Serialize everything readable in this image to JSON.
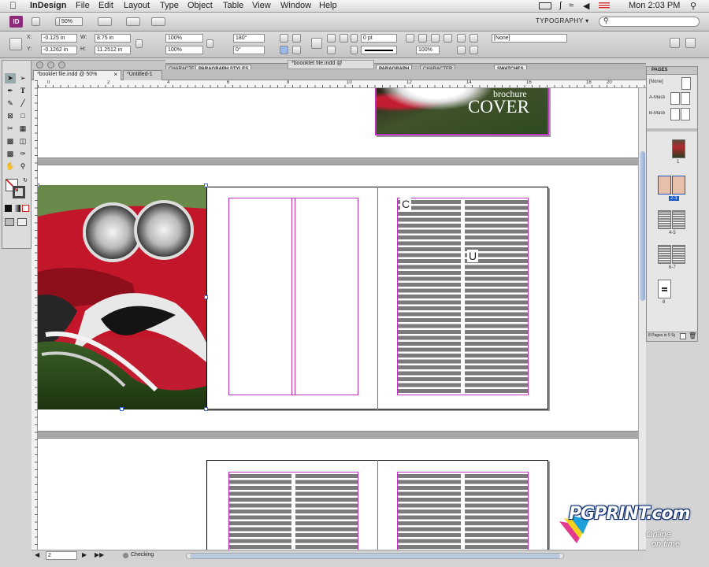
{
  "menubar": {
    "app_name": "InDesign",
    "items": [
      "File",
      "Edit",
      "Layout",
      "Type",
      "Object",
      "Table",
      "View",
      "Window",
      "Help"
    ],
    "clock": "Mon 2:03 PM"
  },
  "appbar": {
    "logo": "ID",
    "zoom": "50%",
    "workspace": "TYPOGRAPHY ▾"
  },
  "control": {
    "x_label": "X:",
    "x_value": "-0.125 in",
    "y_label": "Y:",
    "y_value": "-0.1262 in",
    "w_label": "W:",
    "w_value": "8.75 in",
    "h_label": "H:",
    "h_value": "11.2512 in",
    "scale_x": "100%",
    "scale_y": "100%",
    "rotate": "180°",
    "shear": "0°",
    "stroke": "0 pt",
    "style": "[None]",
    "opacity": "100%"
  },
  "panel_tabs": {
    "group1": [
      "CHARACTE",
      "PARAGRAPH STYLES"
    ],
    "group2": [
      "PARAGRAPH",
      "CHARACTER"
    ],
    "group3": [
      "SWATCHES"
    ]
  },
  "doc_tabs": [
    {
      "label": "*booklet file.indd @ 50%",
      "active": true
    },
    {
      "label": "*Untitled-1",
      "active": false
    },
    {
      "label": "*boooklet file.indd @",
      "active": false
    }
  ],
  "ruler": {
    "ticks": [
      "0",
      "2",
      "4",
      "6",
      "8",
      "10",
      "12",
      "14",
      "16",
      "18",
      "20"
    ]
  },
  "cover": {
    "small": "brochure",
    "big": "COVER"
  },
  "spread2": {
    "text_glyph_left": "C",
    "text_glyph_right": "U"
  },
  "pages_panel": {
    "title": "PAGES",
    "masters": [
      "[None]",
      "A-Master",
      "B-Master"
    ],
    "labels": [
      "1",
      "2-3",
      "4-5",
      "6-7",
      "8"
    ],
    "footer": "8 Pages in 5 Spreads"
  },
  "status": {
    "page": "2",
    "preflight": "Checking"
  },
  "watermark": {
    "brand": "PGPRINT.com",
    "tag1": "Online",
    "tag2": "on time"
  },
  "colors": {
    "accent": "#c030c0",
    "app_logo": "#8e2c79",
    "gutter": "#a8a8a8"
  }
}
